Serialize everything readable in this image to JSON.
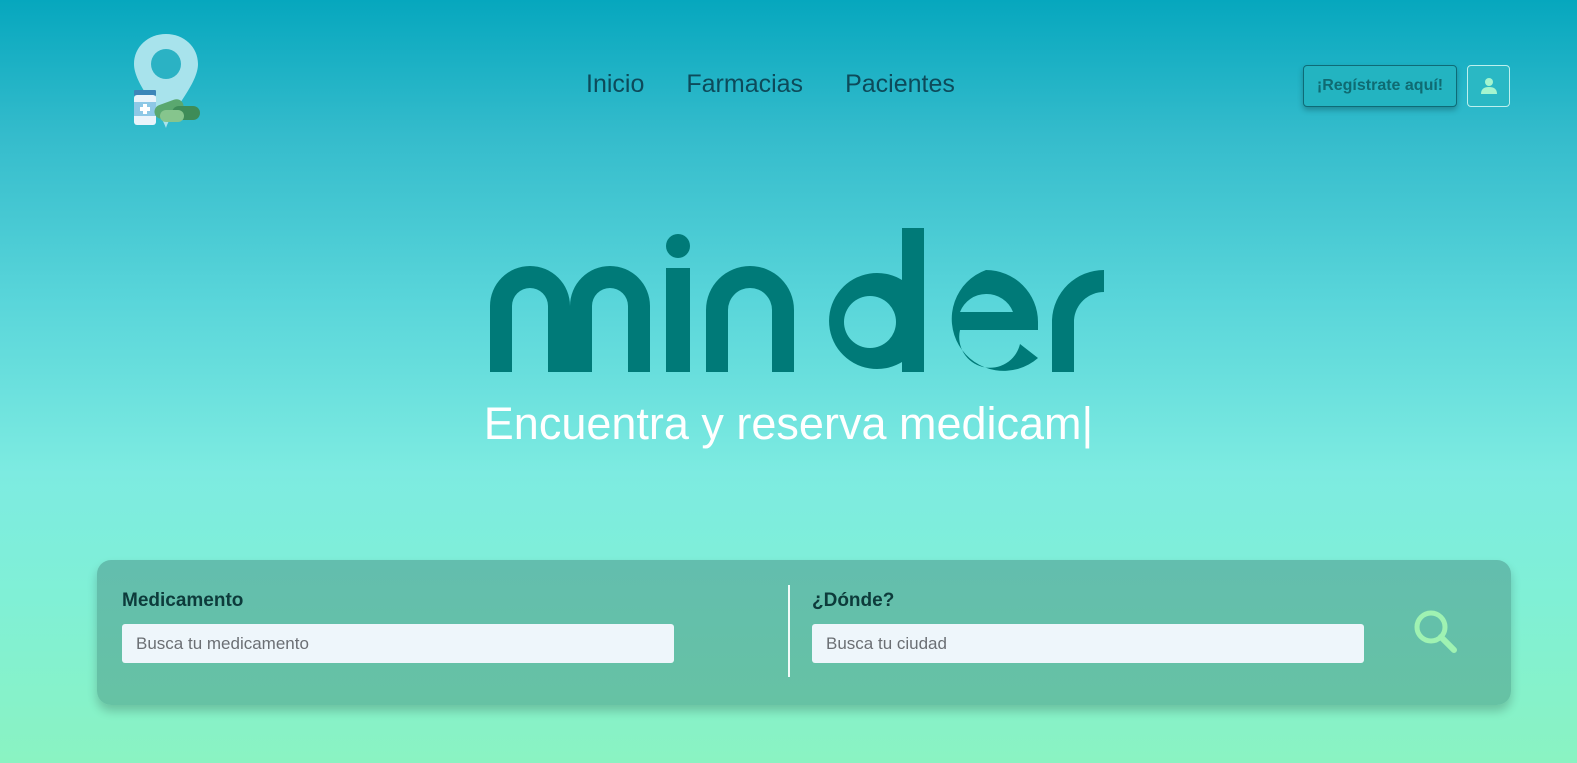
{
  "brand": {
    "name": "minder",
    "logo_icon": "pharmacy-location-pin-icon"
  },
  "nav": {
    "items": [
      "Inicio",
      "Farmacias",
      "Pacientes"
    ]
  },
  "header": {
    "register_label": "¡Regístrate aquí!",
    "user_icon": "user-icon"
  },
  "hero": {
    "tagline": "Encuentra y reserva medicam|"
  },
  "search": {
    "medicine": {
      "label": "Medicamento",
      "placeholder": "Busca tu medicamento",
      "value": ""
    },
    "location": {
      "label": "¿Dónde?",
      "placeholder": "Busca tu ciudad",
      "value": ""
    },
    "button_icon": "search-icon"
  },
  "colors": {
    "wordmark": "#007a78",
    "nav_text": "#0d4a5a",
    "search_icon": "#9ff2b2"
  }
}
